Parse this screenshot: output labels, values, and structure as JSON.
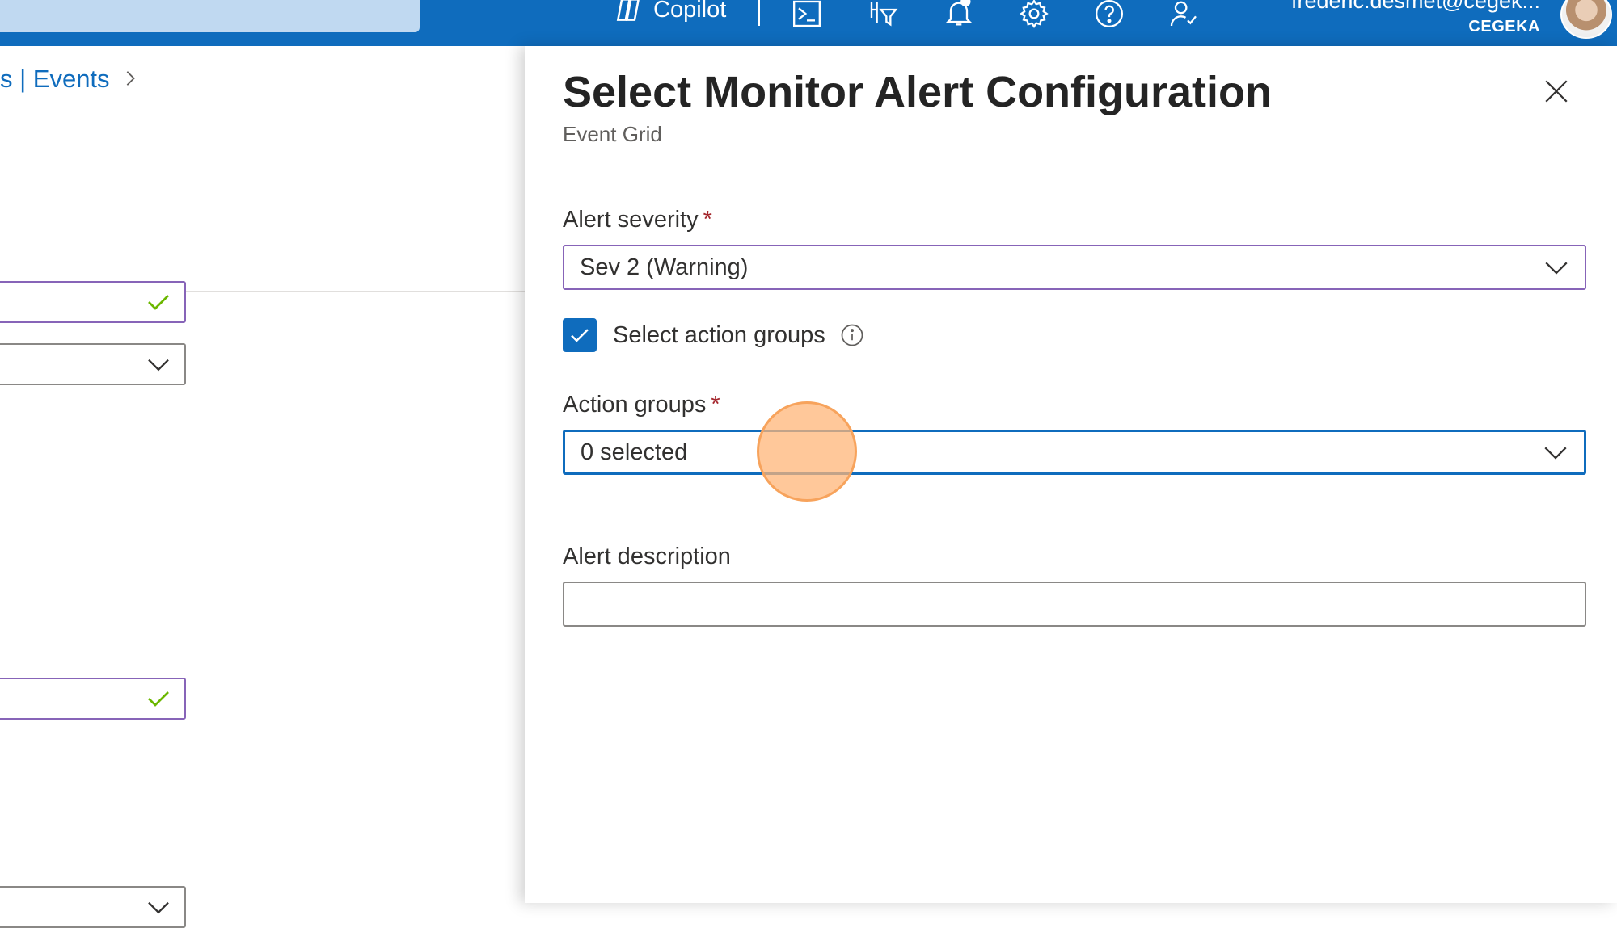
{
  "topbar": {
    "copilot_label": "Copilot",
    "user_email": "frederic.desmet@cegek...",
    "user_org": "CEGEKA",
    "icons": [
      "copilot-icon",
      "cloud-shell-icon",
      "directory-filter-icon",
      "notifications-icon",
      "settings-icon",
      "help-icon",
      "feedback-icon"
    ]
  },
  "breadcrumb": {
    "text": "s | Events"
  },
  "panel": {
    "title": "Select Monitor Alert Configuration",
    "subtitle": "Event Grid",
    "alert_severity": {
      "label": "Alert severity",
      "required_mark": "*",
      "value": "Sev 2 (Warning)"
    },
    "select_action_groups": {
      "label": "Select action groups",
      "checked": true
    },
    "action_groups": {
      "label": "Action groups",
      "required_mark": "*",
      "value": "0 selected"
    },
    "alert_description": {
      "label": "Alert description",
      "value": ""
    }
  },
  "colors": {
    "topbar": "#0f6cbd",
    "accent": "#0f6cbd",
    "valid_border": "#8764b8",
    "required": "#a4262c",
    "valid_check": "#6bb700",
    "cursor_highlight": "#f7a35c"
  }
}
